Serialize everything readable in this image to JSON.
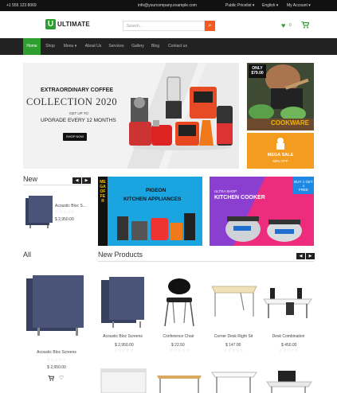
{
  "topbar": {
    "phone": "+1 555 123 8069",
    "email": "info@yourcompany.example.com",
    "pricelist": "Public Pricelist ▾",
    "language": "English ▾",
    "account": "My Account ▾"
  },
  "brand": {
    "mark": "U",
    "name": "ULTIMATE"
  },
  "search": {
    "placeholder": "Search..."
  },
  "header_icons": {
    "wishlist": "♥",
    "wishlist_count": "0",
    "cart": "🛒"
  },
  "nav": [
    "Home",
    "Shop",
    "Menu ▾",
    "About Us",
    "Services",
    "Gallery",
    "Blog",
    "Contact us"
  ],
  "hero": {
    "kicker": "EXTRAORDINARY COFFEE",
    "headline": "COLLECTION 2020",
    "sub1": "GET UP TO",
    "sub2": "UPGRADE EVERY 12 MONTHS",
    "cta": "SHOP NOW"
  },
  "promo_top": {
    "badge_line1": "ONLY",
    "badge_line2": "$79.00",
    "caption": "COOKWARE"
  },
  "promo_sale": {
    "line1": "MEGA SALE",
    "line2": "50% OFF"
  },
  "new_section": {
    "title": "New",
    "product": {
      "name": "Acoustic Bloc S...",
      "price": "$ 2,950.00"
    }
  },
  "banner_mega": {
    "side": "MEGA OFFER",
    "title_line1": "PIGEON",
    "title_line2": "KITCHEN APPLIANCES"
  },
  "banner_ultra": {
    "kicker": "ULTRA SHOP",
    "title": "KITCHEN COOKER",
    "badge_line1": "BUY 1 GET 1",
    "badge_line2": "FREE"
  },
  "all_section": {
    "title": "All",
    "product": {
      "name": "Acoustic Bloc Screens",
      "price": "$ 2,950.00"
    }
  },
  "new_products": {
    "title": "New Products",
    "items": [
      {
        "name": "Acoustic Bloc Screens",
        "price": "$ 2,950.00"
      },
      {
        "name": "Conference Chair",
        "price": "$ 22.50"
      },
      {
        "name": "Corner Desk Right Sit",
        "price": "$ 147.00"
      },
      {
        "name": "Desk Combination",
        "price": "$ 450.00"
      }
    ]
  },
  "ui": {
    "arrow_prev": "◀",
    "arrow_next": "▶",
    "cart_icon": "🛒",
    "heart_icon": "♡",
    "rating": "☆☆☆☆☆"
  }
}
